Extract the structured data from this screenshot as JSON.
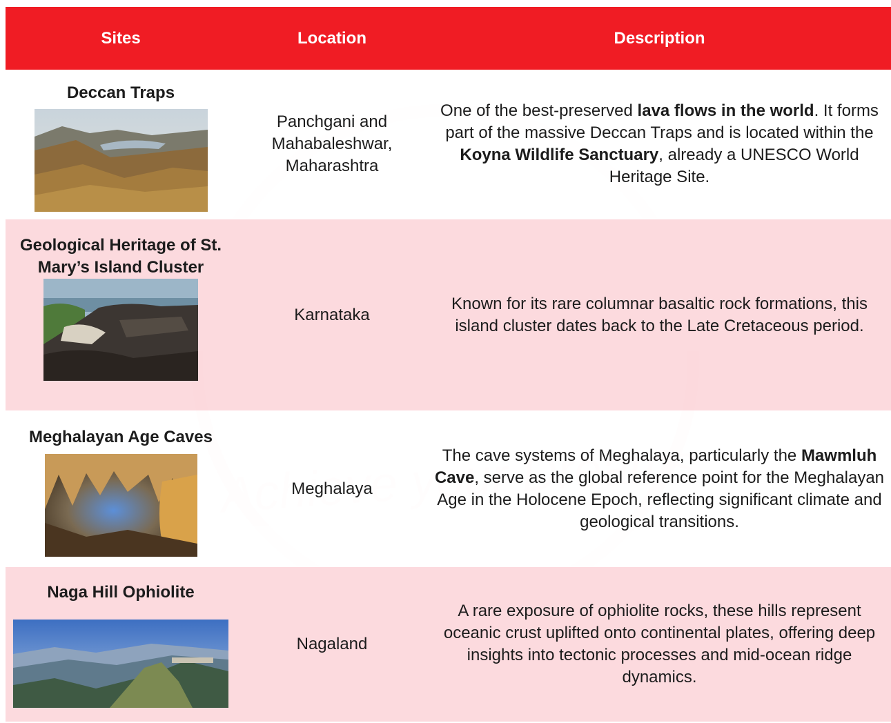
{
  "headers": {
    "sites": "Sites",
    "location": "Location",
    "description": "Description"
  },
  "rows": [
    {
      "site": "Deccan Traps",
      "image": "hill-landscape-photo",
      "location": "Panchgani and Mahabaleshwar, Maharashtra",
      "desc": {
        "p1": "One of the best-preserved ",
        "b1": "lava flows in the world",
        "p2": ". It forms part of the massive Deccan Traps and is located within the ",
        "b2": "Koyna Wildlife Sanctuary",
        "p3": ", already a UNESCO World Heritage Site."
      }
    },
    {
      "site": "Geological Heritage of St. Mary’s Island Cluster",
      "image": "coastal-basalt-rocks-photo",
      "location": "Karnataka",
      "desc": {
        "p1": "Known for its rare columnar basaltic rock formations, this island cluster dates back to the Late Cretaceous period."
      }
    },
    {
      "site": "Meghalayan Age Caves",
      "image": "cave-stalactites-photo",
      "location": "Meghalaya",
      "desc": {
        "p1": "The cave systems of Meghalaya, particularly the ",
        "b1": "Mawmluh Cave",
        "p2": ", serve as the global reference point for the Meghalayan Age in the Holocene Epoch, reflecting significant climate and geological transitions."
      }
    },
    {
      "site": "Naga Hill Ophiolite",
      "image": "mountain-ridge-photo",
      "location": "Nagaland",
      "desc": {
        "p1": "A rare exposure of ophiolite rocks, these hills represent oceanic crust uplifted onto continental plates, offering deep insights into tectonic processes and mid-ocean ridge dynamics."
      }
    }
  ],
  "watermark": {
    "text": "Achieve your Dreams"
  },
  "colors": {
    "header": "#f01c24",
    "pink_row": "#fcd7db"
  }
}
